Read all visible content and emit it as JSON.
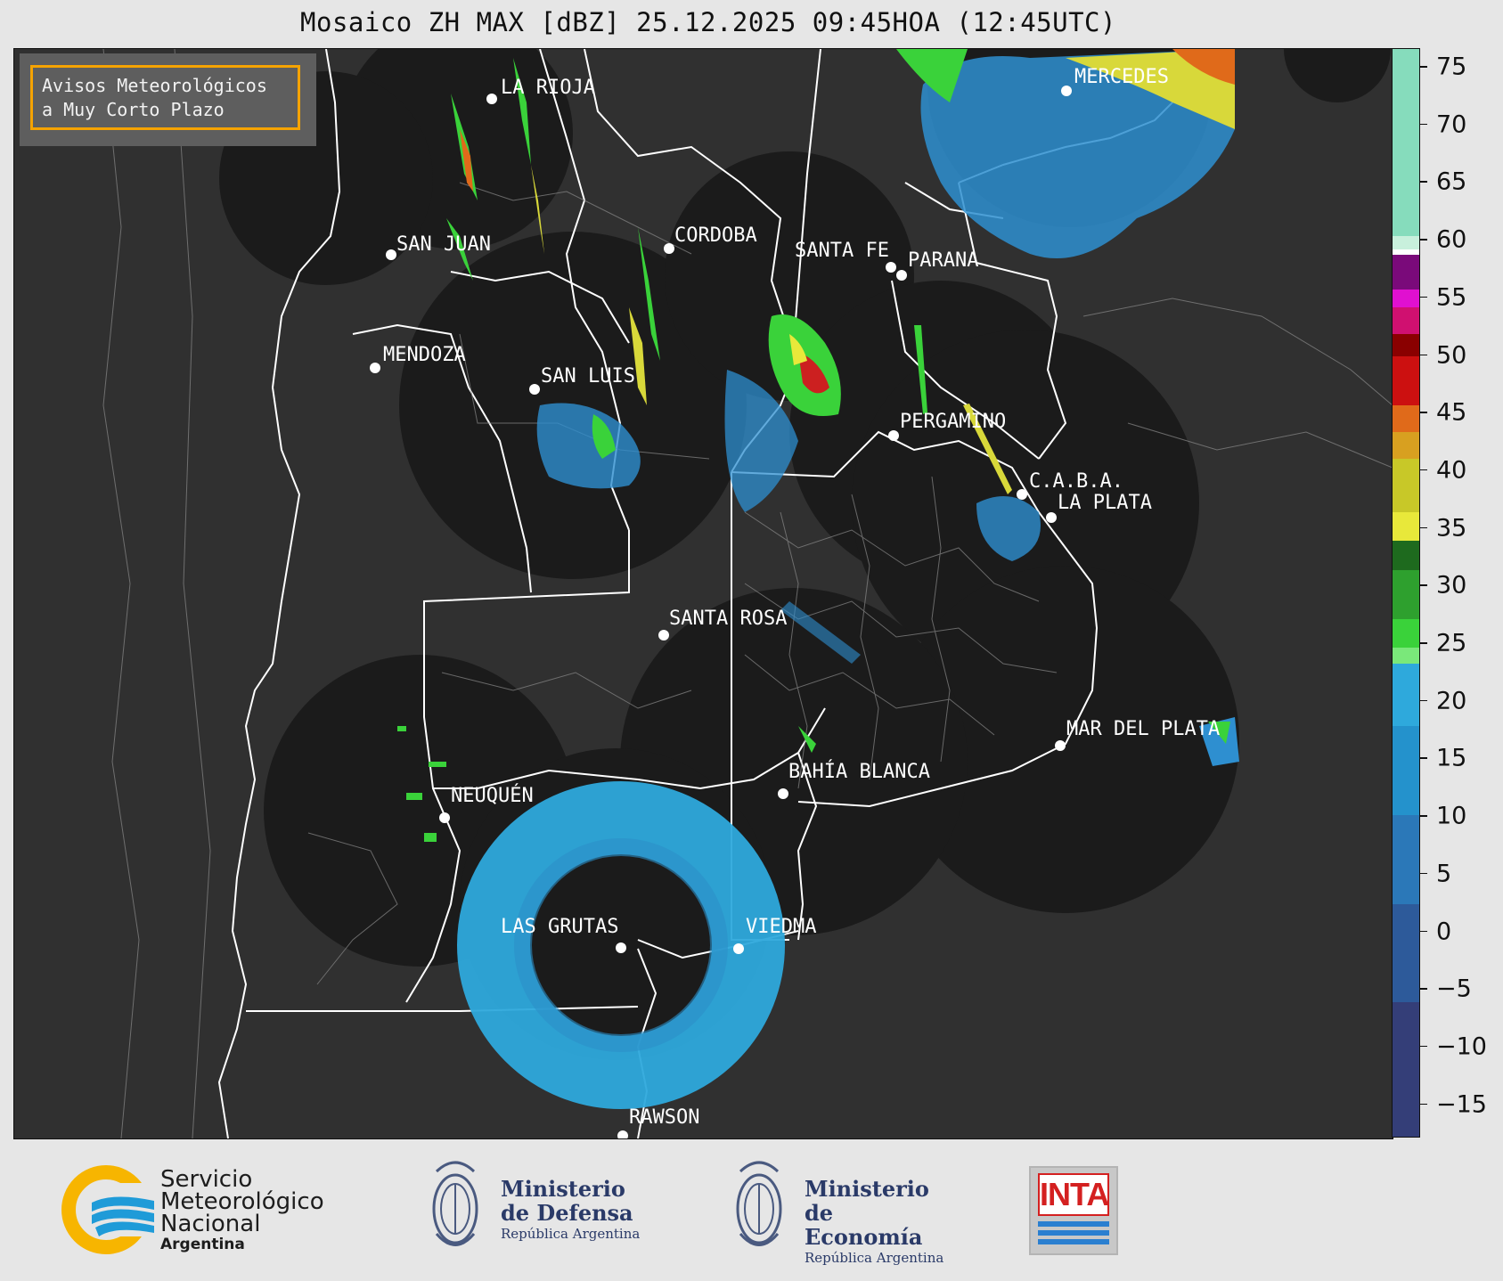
{
  "title": "Mosaico ZH MAX [dBZ] 25.12.2025 09:45HOA (12:45UTC)",
  "notice": {
    "line1": "Avisos Meteorológicos",
    "line2": "a Muy Corto Plazo"
  },
  "cities": [
    {
      "name": "LA RIOJA"
    },
    {
      "name": "MERCEDES"
    },
    {
      "name": "SAN JUAN"
    },
    {
      "name": "CORDOBA"
    },
    {
      "name": "SANTA FE"
    },
    {
      "name": "PARANA"
    },
    {
      "name": "MENDOZA"
    },
    {
      "name": "SAN LUIS"
    },
    {
      "name": "PERGAMINO"
    },
    {
      "name": "C.A.B.A."
    },
    {
      "name": "LA PLATA"
    },
    {
      "name": "SANTA ROSA"
    },
    {
      "name": "MAR DEL PLATA"
    },
    {
      "name": "BAHÍA BLANCA"
    },
    {
      "name": "NEUQUÉN"
    },
    {
      "name": "LAS GRUTAS"
    },
    {
      "name": "VIEDMA"
    },
    {
      "name": "RAWSON"
    }
  ],
  "colorbar": {
    "unit": "dBZ",
    "ticks": [
      "75",
      "70",
      "65",
      "60",
      "55",
      "50",
      "45",
      "40",
      "35",
      "30",
      "25",
      "20",
      "15",
      "10",
      "5",
      "0",
      "−5",
      "−10",
      "−15"
    ],
    "colors": {
      "light_blue": "#2ea9dc",
      "green": "#3ad23a",
      "yellow": "#e8e83a",
      "orange": "#e08a1a",
      "red": "#cc1010",
      "magenta": "#e010d0",
      "mint": "#8cdcbc"
    }
  },
  "colors": {
    "map_background": "#2e2e2e",
    "radar_coverage": "#1b1b1b",
    "notice_border": "#f5a300"
  },
  "footer": {
    "smn": {
      "line1": "Servicio",
      "line2": "Meteorológico",
      "line3": "Nacional",
      "line4": "Argentina"
    },
    "defensa": {
      "line1": "Ministerio",
      "line2": "de Defensa",
      "line3": "República Argentina"
    },
    "economia": {
      "line1": "Ministerio",
      "line2": "de Economía",
      "line3": "República Argentina"
    },
    "inta": {
      "label": "INTA"
    }
  }
}
